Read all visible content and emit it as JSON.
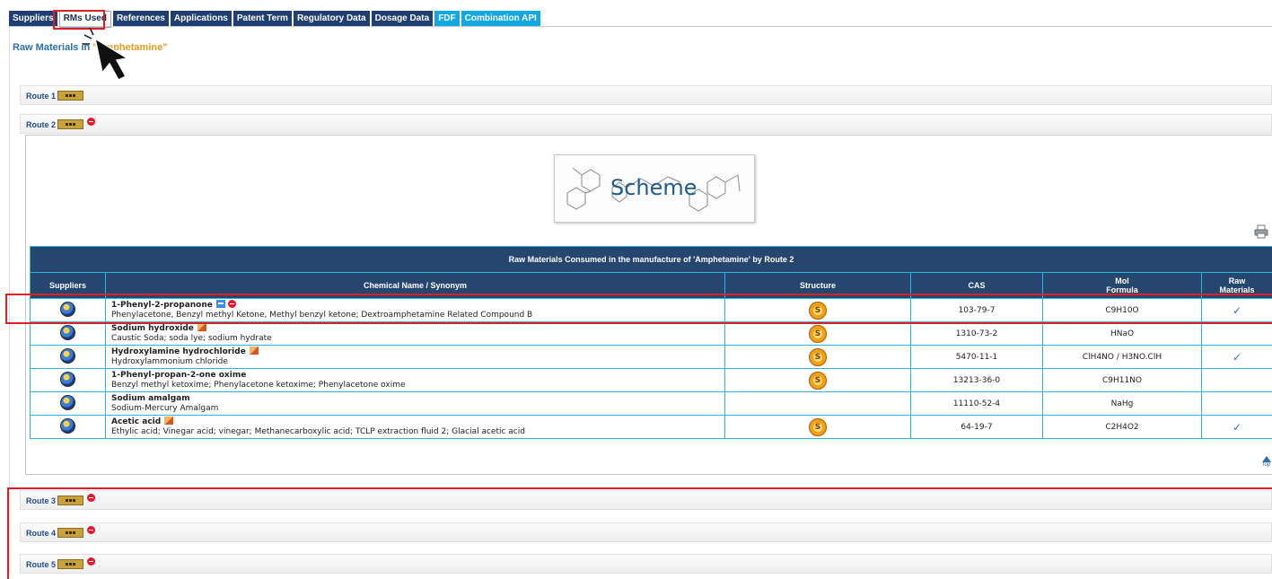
{
  "tabs": [
    {
      "label": "Suppliers",
      "style": "dark"
    },
    {
      "label": "RMs Used",
      "style": "active"
    },
    {
      "label": "References",
      "style": "dark"
    },
    {
      "label": "Applications",
      "style": "dark"
    },
    {
      "label": "Patent Term",
      "style": "dark"
    },
    {
      "label": "Regulatory Data",
      "style": "dark"
    },
    {
      "label": "Dosage Data",
      "style": "dark"
    },
    {
      "label": "FDF",
      "style": "light"
    },
    {
      "label": "Combination API",
      "style": "light"
    }
  ],
  "header": {
    "title_prefix": "Raw Materials in ",
    "product_quoted": "\"Amphetamine\""
  },
  "routes": {
    "route1": "Route 1",
    "route2": "Route 2",
    "route3": "Route 3",
    "route4": "Route 4",
    "route5": "Route 5"
  },
  "scheme": {
    "label": "Scheme"
  },
  "table": {
    "caption": "Raw Materials Consumed in the manufacture of 'Amphetamine' by Route 2",
    "columns": {
      "suppliers": "Suppliers",
      "name": "Chemical Name / Synonym",
      "structure": "Structure",
      "cas": "CAS",
      "mol_1": "Mol",
      "mol_2": "Formula",
      "raw_1": "Raw",
      "raw_2": "Materials"
    },
    "rows": [
      {
        "name": "1-Phenyl-2-propanone",
        "synonyms": "Phenylacetone, Benzyl methyl Ketone, Methyl benzyl ketone; Dextroamphetamine Related Compound B",
        "cas": "103-79-7",
        "formula": "C9H10O",
        "structure": true,
        "raw": true
      },
      {
        "name": "Sodium hydroxide",
        "synonyms": "Caustic Soda; soda lye; sodium hydrate",
        "cas": "1310-73-2",
        "formula": "HNaO",
        "structure": true,
        "raw": false
      },
      {
        "name": "Hydroxylamine hydrochloride",
        "synonyms": "Hydroxylammonium chloride",
        "cas": "5470-11-1",
        "formula": "ClH4NO / H3NO.ClH",
        "structure": true,
        "raw": true
      },
      {
        "name": "1-Phenyl-propan-2-one oxime",
        "synonyms": "Benzyl methyl ketoxime; Phenylacetone ketoxime; Phenylacetone oxime",
        "cas": "13213-36-0",
        "formula": "C9H11NO",
        "structure": true,
        "raw": false
      },
      {
        "name": "Sodium amalgam",
        "synonyms": "Sodium-Mercury Amalgam",
        "cas": "11110-52-4",
        "formula": "NaHg",
        "structure": false,
        "raw": false
      },
      {
        "name": "Acetic acid",
        "synonyms": "Ethylic acid; Vinegar acid; vinegar; Methanecarboxylic acid; TCLP extraction fluid 2; Glacial acetic acid",
        "cas": "64-19-7",
        "formula": "C2H4O2",
        "structure": true,
        "raw": true
      }
    ]
  },
  "top_link": "top",
  "colors": {
    "tab_dark": "#1f3e73",
    "tab_light": "#14a8e2",
    "table_header": "#24466f",
    "table_border": "#2bb6e0",
    "highlight": "#e02020"
  }
}
